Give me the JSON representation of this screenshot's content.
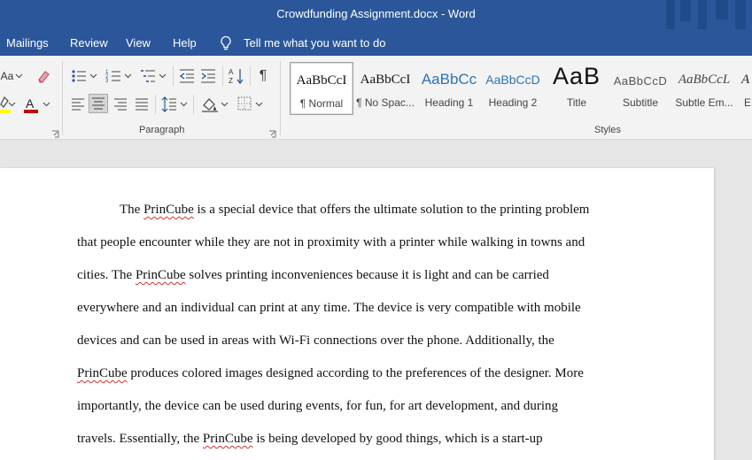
{
  "window": {
    "title": "Crowdfunding Assignment.docx  -  Word"
  },
  "tabs": [
    "Mailings",
    "Review",
    "View",
    "Help"
  ],
  "tell_me": "Tell me what you want to do",
  "ribbon": {
    "font_case_label": "Aa",
    "groups": {
      "paragraph": "Paragraph",
      "styles": "Styles"
    },
    "colors": {
      "highlight": "#ffff00",
      "font_color": "#c00000"
    },
    "icons": [
      "change-case-icon",
      "clear-formatting-icon",
      "text-highlight-color-icon",
      "font-color-icon",
      "bullets-icon",
      "numbering-icon",
      "multilevel-list-icon",
      "decrease-indent-icon",
      "increase-indent-icon",
      "sort-icon",
      "show-hide-formatting-icon",
      "align-left-icon",
      "align-center-icon",
      "align-right-icon",
      "justify-icon",
      "line-spacing-icon",
      "shading-icon",
      "borders-icon"
    ]
  },
  "styles": [
    {
      "sample": "AaBbCcI",
      "label": "¶ Normal",
      "selected": true
    },
    {
      "sample": "AaBbCcI",
      "label": "¶ No Spac..."
    },
    {
      "sample": "AaBbCc",
      "label": "Heading 1"
    },
    {
      "sample": "AaBbCcD",
      "label": "Heading 2"
    },
    {
      "sample": "AaB",
      "label": "Title"
    },
    {
      "sample": "AaBbCcD",
      "label": "Subtitle"
    },
    {
      "sample": "AaBbCcL",
      "label": "Subtle Em..."
    },
    {
      "sample": "A",
      "label": "E"
    }
  ],
  "document": {
    "lines": [
      [
        {
          "t": "The "
        },
        {
          "t": "PrinCube",
          "sq": true
        },
        {
          "t": " is a special device that offers the ultimate solution to the printing problem"
        }
      ],
      [
        {
          "t": "that people encounter while they are not in proximity with a printer while walking in towns and"
        }
      ],
      [
        {
          "t": "cities. The "
        },
        {
          "t": "PrinCube",
          "sq": true
        },
        {
          "t": " solves printing inconveniences because it is light and can be carried"
        }
      ],
      [
        {
          "t": "everywhere and an individual can print at any time. The device is very compatible with mobile"
        }
      ],
      [
        {
          "t": "devices and can be used in areas with Wi-Fi connections over the phone. Additionally, the"
        }
      ],
      [
        {
          "t": "PrinCube",
          "sq": true
        },
        {
          "t": " produces colored images designed according to the preferences of the designer. More"
        }
      ],
      [
        {
          "t": "importantly, the device can be used during events, for fun, for art development, and during"
        }
      ],
      [
        {
          "t": "travels. Essentially, the "
        },
        {
          "t": "PrinCube",
          "sq": true
        },
        {
          "t": " is being developed by good things, which is a start-up"
        }
      ]
    ]
  }
}
